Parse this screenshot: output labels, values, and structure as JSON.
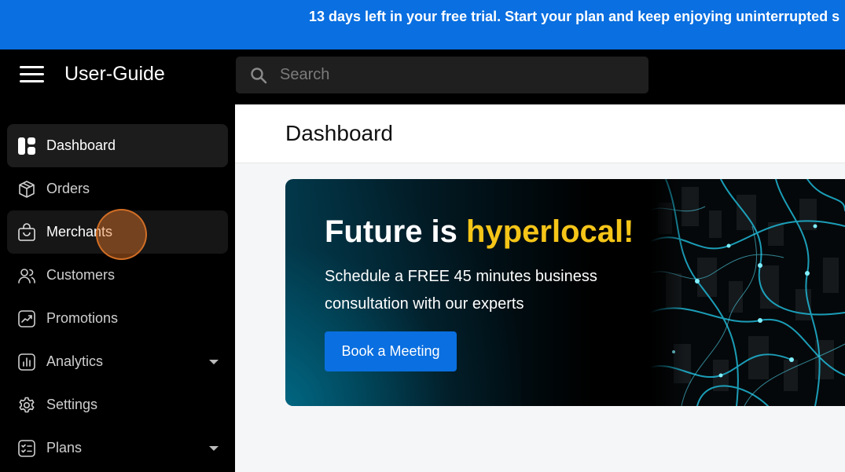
{
  "banner": {
    "text": "13 days left in your free trial. Start your plan and keep enjoying uninterrupted s"
  },
  "header": {
    "app_title": "User-Guide",
    "menu_icon": "hamburger-menu-icon",
    "search": {
      "icon": "search-icon",
      "placeholder": "Search",
      "value": ""
    }
  },
  "sidebar": {
    "items": [
      {
        "label": "Dashboard",
        "icon": "dashboard-icon",
        "active": true
      },
      {
        "label": "Orders",
        "icon": "box-icon"
      },
      {
        "label": "Merchants",
        "icon": "shopping-bag-icon"
      },
      {
        "label": "Customers",
        "icon": "users-icon"
      },
      {
        "label": "Promotions",
        "icon": "trending-chart-icon"
      },
      {
        "label": "Analytics",
        "icon": "bar-chart-icon",
        "expandable": true
      },
      {
        "label": "Settings",
        "icon": "gear-icon"
      },
      {
        "label": "Plans",
        "icon": "checklist-icon",
        "expandable": true
      }
    ]
  },
  "main": {
    "page_title": "Dashboard",
    "promo": {
      "heading_prefix": "Future is ",
      "heading_highlight": "hyperlocal!",
      "subtitle": "Schedule a FREE 45 minutes business consultation with our experts",
      "button_label": "Book a Meeting"
    }
  },
  "colors": {
    "banner_bg": "#0a6fe0",
    "accent_blue": "#0a6fe0",
    "highlight_yellow": "#f5c518",
    "sidebar_bg": "#000000",
    "click_marker": "#e67828"
  }
}
